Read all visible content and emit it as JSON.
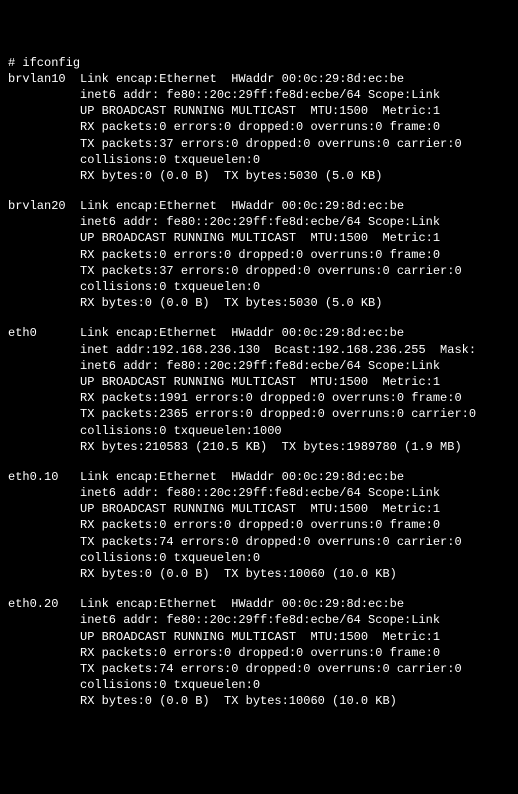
{
  "prompt": "# ",
  "command": "ifconfig",
  "interfaces": [
    {
      "name": "brvlan10",
      "encap": "Link encap:Ethernet  HWaddr 00:0c:29:8d:ec:be",
      "inet6": "inet6 addr: fe80::20c:29ff:fe8d:ecbe/64 Scope:Link",
      "flags": "UP BROADCAST RUNNING MULTICAST  MTU:1500  Metric:1",
      "rx_packets": "RX packets:0 errors:0 dropped:0 overruns:0 frame:0",
      "tx_packets": "TX packets:37 errors:0 dropped:0 overruns:0 carrier:0",
      "collisions": "collisions:0 txqueuelen:0",
      "bytes": "RX bytes:0 (0.0 B)  TX bytes:5030 (5.0 KB)"
    },
    {
      "name": "brvlan20",
      "encap": "Link encap:Ethernet  HWaddr 00:0c:29:8d:ec:be",
      "inet6": "inet6 addr: fe80::20c:29ff:fe8d:ecbe/64 Scope:Link",
      "flags": "UP BROADCAST RUNNING MULTICAST  MTU:1500  Metric:1",
      "rx_packets": "RX packets:0 errors:0 dropped:0 overruns:0 frame:0",
      "tx_packets": "TX packets:37 errors:0 dropped:0 overruns:0 carrier:0",
      "collisions": "collisions:0 txqueuelen:0",
      "bytes": "RX bytes:0 (0.0 B)  TX bytes:5030 (5.0 KB)"
    },
    {
      "name": "eth0",
      "encap": "Link encap:Ethernet  HWaddr 00:0c:29:8d:ec:be",
      "inet": "inet addr:192.168.236.130  Bcast:192.168.236.255  Mask:",
      "inet6": "inet6 addr: fe80::20c:29ff:fe8d:ecbe/64 Scope:Link",
      "flags": "UP BROADCAST RUNNING MULTICAST  MTU:1500  Metric:1",
      "rx_packets": "RX packets:1991 errors:0 dropped:0 overruns:0 frame:0",
      "tx_packets": "TX packets:2365 errors:0 dropped:0 overruns:0 carrier:0",
      "collisions": "collisions:0 txqueuelen:1000",
      "bytes": "RX bytes:210583 (210.5 KB)  TX bytes:1989780 (1.9 MB)"
    },
    {
      "name": "eth0.10",
      "encap": "Link encap:Ethernet  HWaddr 00:0c:29:8d:ec:be",
      "inet6": "inet6 addr: fe80::20c:29ff:fe8d:ecbe/64 Scope:Link",
      "flags": "UP BROADCAST RUNNING MULTICAST  MTU:1500  Metric:1",
      "rx_packets": "RX packets:0 errors:0 dropped:0 overruns:0 frame:0",
      "tx_packets": "TX packets:74 errors:0 dropped:0 overruns:0 carrier:0",
      "collisions": "collisions:0 txqueuelen:0",
      "bytes": "RX bytes:0 (0.0 B)  TX bytes:10060 (10.0 KB)"
    },
    {
      "name": "eth0.20",
      "encap": "Link encap:Ethernet  HWaddr 00:0c:29:8d:ec:be",
      "inet6": "inet6 addr: fe80::20c:29ff:fe8d:ecbe/64 Scope:Link",
      "flags": "UP BROADCAST RUNNING MULTICAST  MTU:1500  Metric:1",
      "rx_packets": "RX packets:0 errors:0 dropped:0 overruns:0 frame:0",
      "tx_packets": "TX packets:74 errors:0 dropped:0 overruns:0 carrier:0",
      "collisions": "collisions:0 txqueuelen:0",
      "bytes": "RX bytes:0 (0.0 B)  TX bytes:10060 (10.0 KB)"
    }
  ]
}
